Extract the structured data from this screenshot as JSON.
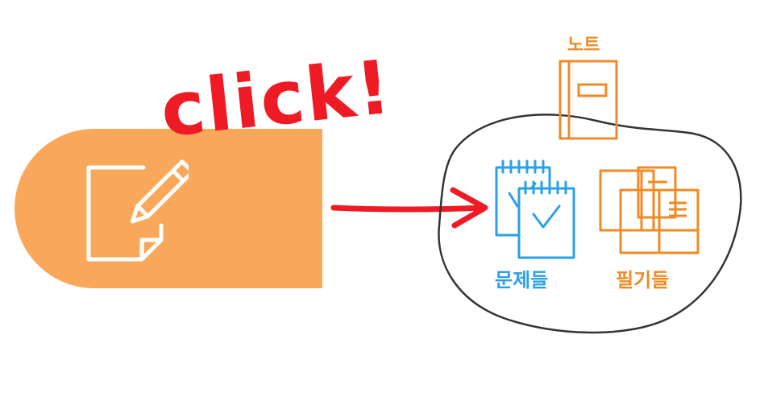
{
  "button": {
    "icon": "edit-note-icon",
    "color": "#f9a75a"
  },
  "callout": {
    "text": "click!",
    "color": "#ee1b24"
  },
  "group": {
    "items": [
      {
        "label": "노트",
        "icon": "notebook-icon",
        "color": "#f08a24"
      },
      {
        "label": "문제들",
        "icon": "checklist-notepads-icon",
        "color": "#2aa0e6"
      },
      {
        "label": "필기들",
        "icon": "memo-sheets-icon",
        "color": "#f08a24"
      }
    ]
  }
}
